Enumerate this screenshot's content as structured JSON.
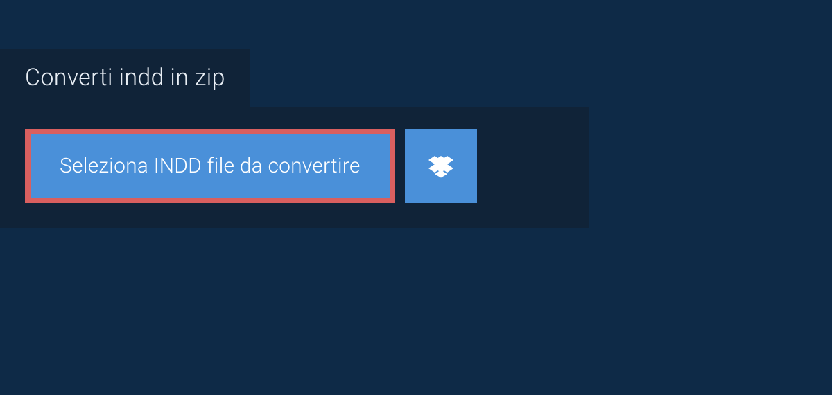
{
  "tab": {
    "label": "Converti indd in zip"
  },
  "actions": {
    "select_file_label": "Seleziona INDD file da convertire"
  },
  "colors": {
    "page_bg": "#0e2a47",
    "panel_bg": "#102338",
    "button_bg": "#4a90d9",
    "highlight_border": "#d95f5f",
    "text": "#ffffff"
  }
}
